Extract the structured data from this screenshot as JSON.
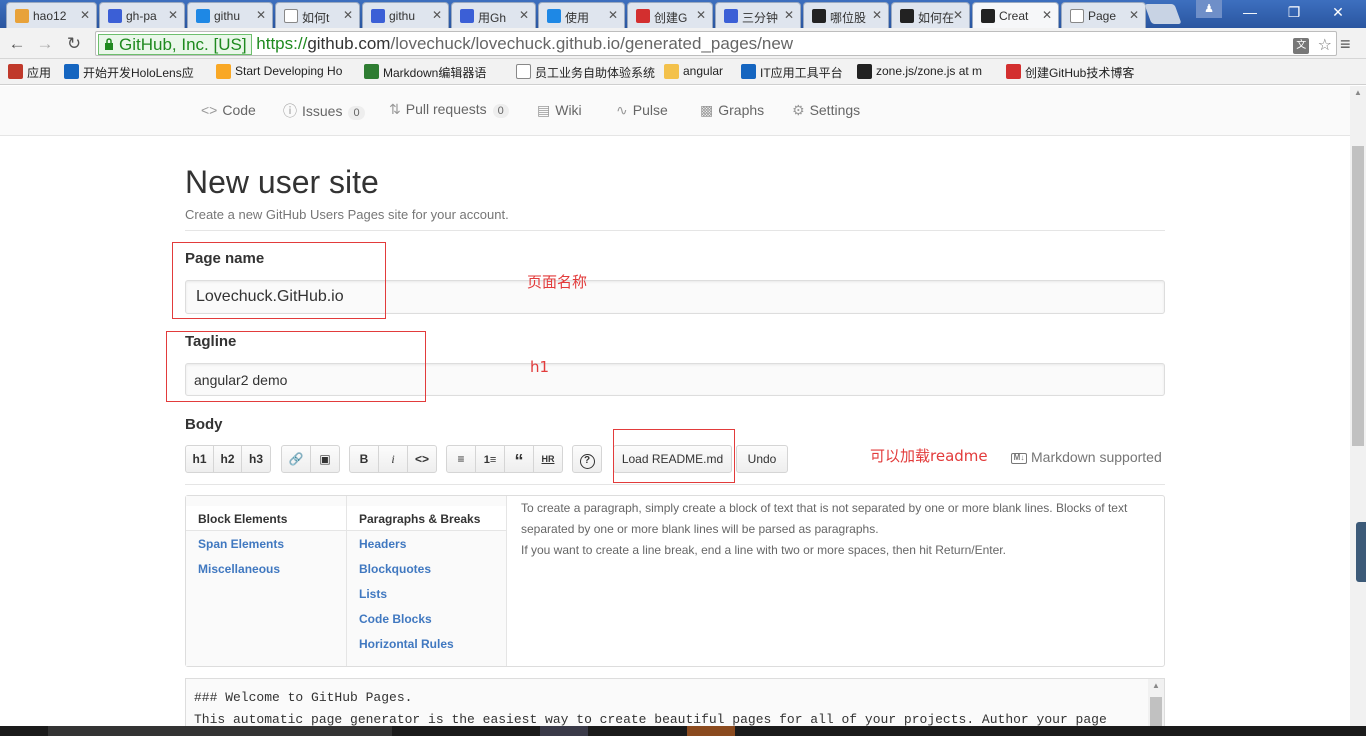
{
  "browser": {
    "tabs": [
      {
        "label": "hao12",
        "icon": "hao-icon",
        "color": "#e8a23a"
      },
      {
        "label": "gh-pa",
        "icon": "paw-icon",
        "color": "#3b5fd6"
      },
      {
        "label": "githu",
        "icon": "zhihu-icon",
        "color": "#1e88e5"
      },
      {
        "label": "如何t",
        "icon": "page-icon",
        "color": "#ffffff"
      },
      {
        "label": "githu",
        "icon": "paw-icon",
        "color": "#3b5fd6"
      },
      {
        "label": "用Gh",
        "icon": "paw-icon",
        "color": "#3b5fd6"
      },
      {
        "label": "使用",
        "icon": "zhihu-icon",
        "color": "#1e88e5"
      },
      {
        "label": "创建G",
        "icon": "csdn-icon",
        "color": "#d32f2f"
      },
      {
        "label": "三分钟",
        "icon": "paw-icon",
        "color": "#3b5fd6"
      },
      {
        "label": "哪位股",
        "icon": "github-icon",
        "color": "#222222"
      },
      {
        "label": "如何在",
        "icon": "github-icon",
        "color": "#222222"
      },
      {
        "label": "Creat",
        "icon": "github-icon",
        "color": "#222222",
        "active": true
      },
      {
        "label": "Page",
        "icon": "page-icon",
        "color": "#ffffff"
      }
    ],
    "ev_label": "GitHub, Inc. [US]",
    "url_scheme": "https://",
    "url_host": "github.com",
    "url_path": "/lovechuck/lovechuck.github.io/generated_pages/new",
    "bookmarks": [
      {
        "label": "应用",
        "icon": "apps-icon",
        "color": "#c0392b"
      },
      {
        "label": "开始开发HoloLens应",
        "icon": "holo-icon",
        "color": "#1565c0"
      },
      {
        "label": "Start Developing Ho",
        "icon": "star-icon",
        "color": "#f9a825"
      },
      {
        "label": "Markdown编辑器语",
        "icon": "sf-icon",
        "color": "#2e7d32"
      },
      {
        "label": "员工业务自助体验系统",
        "icon": "page-icon",
        "color": "#ffffff"
      },
      {
        "label": "angular",
        "icon": "folder-icon",
        "color": "#f3c14b"
      },
      {
        "label": "IT应用工具平台",
        "icon": "it-icon",
        "color": "#1565c0"
      },
      {
        "label": "zone.js/zone.js at m",
        "icon": "github-icon",
        "color": "#222222"
      },
      {
        "label": "创建GitHub技术博客",
        "icon": "csdn-icon",
        "color": "#d32f2f"
      }
    ]
  },
  "repo_nav": {
    "code": "Code",
    "issues": "Issues",
    "issues_count": "0",
    "pulls": "Pull requests",
    "pulls_count": "0",
    "wiki": "Wiki",
    "pulse": "Pulse",
    "graphs": "Graphs",
    "settings": "Settings"
  },
  "page": {
    "title": "New user site",
    "subtitle": "Create a new GitHub Users Pages site for your account.",
    "page_name_label": "Page name",
    "page_name_value": "Lovechuck.GitHub.io",
    "tagline_label": "Tagline",
    "tagline_value": "angular2 demo",
    "body_label": "Body"
  },
  "md_toolbar": {
    "h1": "h1",
    "h2": "h2",
    "h3": "h3",
    "bold": "B",
    "italic": "i",
    "code": "<>",
    "quote": "“",
    "hr": "HR",
    "help": "?",
    "load_readme": "Load README.md",
    "undo": "Undo",
    "md_supported": "Markdown supported",
    "md_badge": "M↓"
  },
  "help": {
    "col1": [
      "Block Elements",
      "Span Elements",
      "Miscellaneous"
    ],
    "col2": [
      "Paragraphs & Breaks",
      "Headers",
      "Blockquotes",
      "Lists",
      "Code Blocks",
      "Horizontal Rules"
    ],
    "body_lines": [
      "To create a paragraph, simply create a block of text that is not separated by one or more blank lines. Blocks of text",
      "separated by one or more blank lines will be parsed as paragraphs.",
      "If you want to create a line break, end a line with two or more spaces, then hit Return/Enter."
    ]
  },
  "editor": {
    "line1": "### Welcome to GitHub Pages.",
    "line2": "This automatic page generator is the easiest way to create beautiful pages for all of your projects. Author your page"
  },
  "annotations": {
    "page_name_note": "页面名称",
    "tagline_note": "h1",
    "readme_note": "可以加载readme",
    "color": "#e23b3b"
  }
}
